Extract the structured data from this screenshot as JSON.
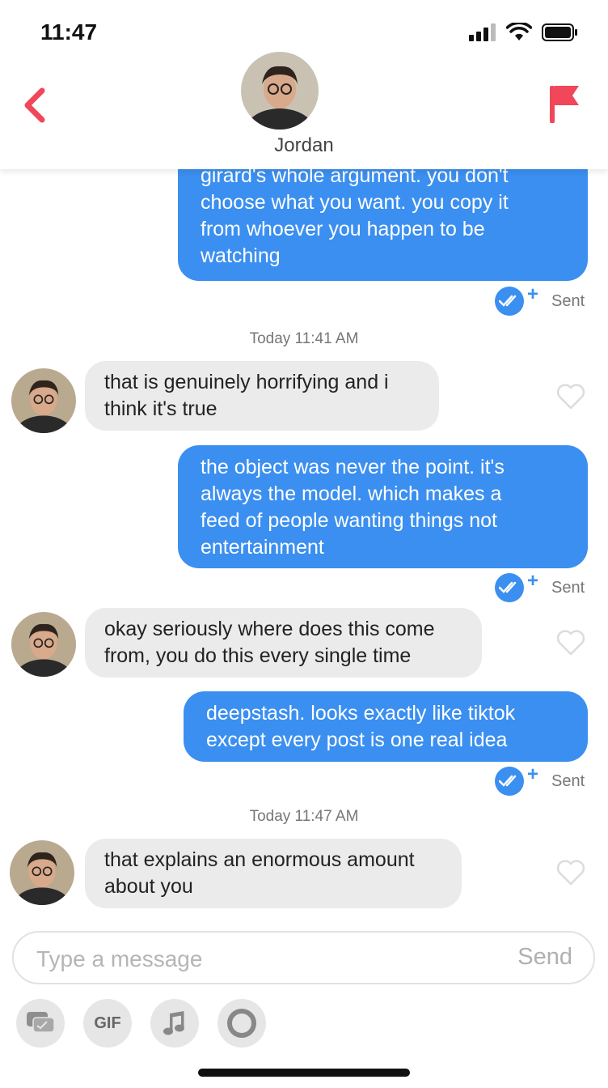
{
  "status_bar": {
    "time": "11:47"
  },
  "header": {
    "name": "Jordan"
  },
  "messages": {
    "m1": {
      "lines": [
        "girard's whole argument. you don't",
        "choose what you want. you copy it",
        "from whoever you happen to be",
        "watching"
      ]
    },
    "m1_status": "Sent",
    "ts1": "Today 11:41 AM",
    "m2": {
      "lines": [
        "that is genuinely horrifying and i",
        "think it's true"
      ]
    },
    "m3": {
      "lines": [
        "the object was never the point. it's",
        "always the model. which makes a",
        "feed of people wanting things not",
        "entertainment"
      ]
    },
    "m3_status": "Sent",
    "m4": {
      "lines": [
        "okay seriously where does this come",
        "from, you do this every single time"
      ]
    },
    "m5": {
      "lines": [
        "deepstash. looks exactly like tiktok",
        "except every post is one real idea"
      ]
    },
    "m5_status": "Sent",
    "ts2": "Today 11:47 AM",
    "m6": {
      "lines": [
        "that explains an enormous amount",
        "about you"
      ]
    }
  },
  "composer": {
    "placeholder": "Type a message",
    "send_label": "Send"
  },
  "toolbar": {
    "gif_label": "GIF"
  },
  "colors": {
    "accent": "#3b8ff0",
    "brand_red": "#f0475a",
    "incoming_bubble": "#ebebeb"
  }
}
